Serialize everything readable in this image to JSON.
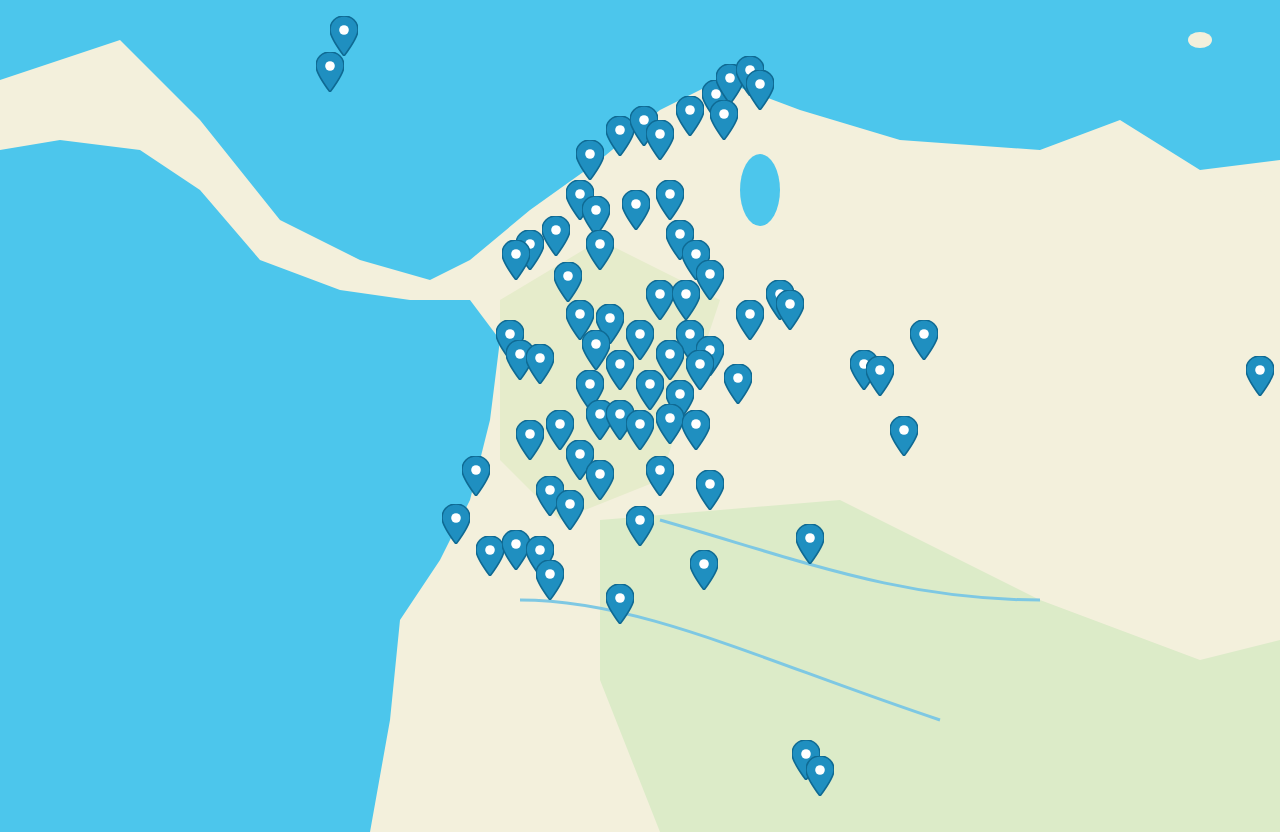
{
  "map": {
    "kind": "street-map"
  },
  "markers": [
    {
      "kind": "pin"
    },
    {
      "kind": "pin"
    },
    {
      "kind": "pin"
    },
    {
      "kind": "pin"
    },
    {
      "kind": "pin"
    },
    {
      "kind": "pin"
    },
    {
      "kind": "pin"
    },
    {
      "kind": "pin"
    },
    {
      "kind": "pin"
    },
    {
      "kind": "pin"
    },
    {
      "kind": "pin"
    },
    {
      "kind": "pin"
    },
    {
      "kind": "pin"
    },
    {
      "kind": "pin"
    },
    {
      "kind": "pin"
    },
    {
      "kind": "pin"
    },
    {
      "kind": "pin"
    },
    {
      "kind": "pin"
    },
    {
      "kind": "pin"
    },
    {
      "kind": "pin"
    },
    {
      "kind": "pin"
    },
    {
      "kind": "pin"
    },
    {
      "kind": "pin"
    },
    {
      "kind": "pin"
    },
    {
      "kind": "pin"
    },
    {
      "kind": "pin"
    },
    {
      "kind": "pin"
    },
    {
      "kind": "pin"
    },
    {
      "kind": "pin"
    },
    {
      "kind": "pin"
    },
    {
      "kind": "pin"
    },
    {
      "kind": "pin"
    },
    {
      "kind": "pin"
    },
    {
      "kind": "pin"
    },
    {
      "kind": "pin"
    },
    {
      "kind": "pin"
    },
    {
      "kind": "pin"
    },
    {
      "kind": "pin"
    },
    {
      "kind": "pin"
    },
    {
      "kind": "pin"
    },
    {
      "kind": "pin"
    },
    {
      "kind": "pin"
    },
    {
      "kind": "pin"
    },
    {
      "kind": "pin"
    },
    {
      "kind": "pin"
    },
    {
      "kind": "pin"
    },
    {
      "kind": "pin"
    },
    {
      "kind": "pin"
    },
    {
      "kind": "pin"
    },
    {
      "kind": "pin"
    },
    {
      "kind": "pin"
    },
    {
      "kind": "pin"
    },
    {
      "kind": "pin"
    },
    {
      "kind": "pin"
    },
    {
      "kind": "pin"
    },
    {
      "kind": "pin"
    },
    {
      "kind": "pin"
    },
    {
      "kind": "pin"
    },
    {
      "kind": "pin"
    },
    {
      "kind": "pin"
    },
    {
      "kind": "pin"
    },
    {
      "kind": "pin"
    },
    {
      "kind": "pin"
    },
    {
      "kind": "pin"
    },
    {
      "kind": "pin"
    },
    {
      "kind": "pin"
    },
    {
      "kind": "pin"
    },
    {
      "kind": "pin"
    },
    {
      "kind": "pin"
    },
    {
      "kind": "pin"
    },
    {
      "kind": "pin"
    },
    {
      "kind": "pin"
    },
    {
      "kind": "pin"
    },
    {
      "kind": "pin"
    },
    {
      "kind": "pin"
    }
  ]
}
